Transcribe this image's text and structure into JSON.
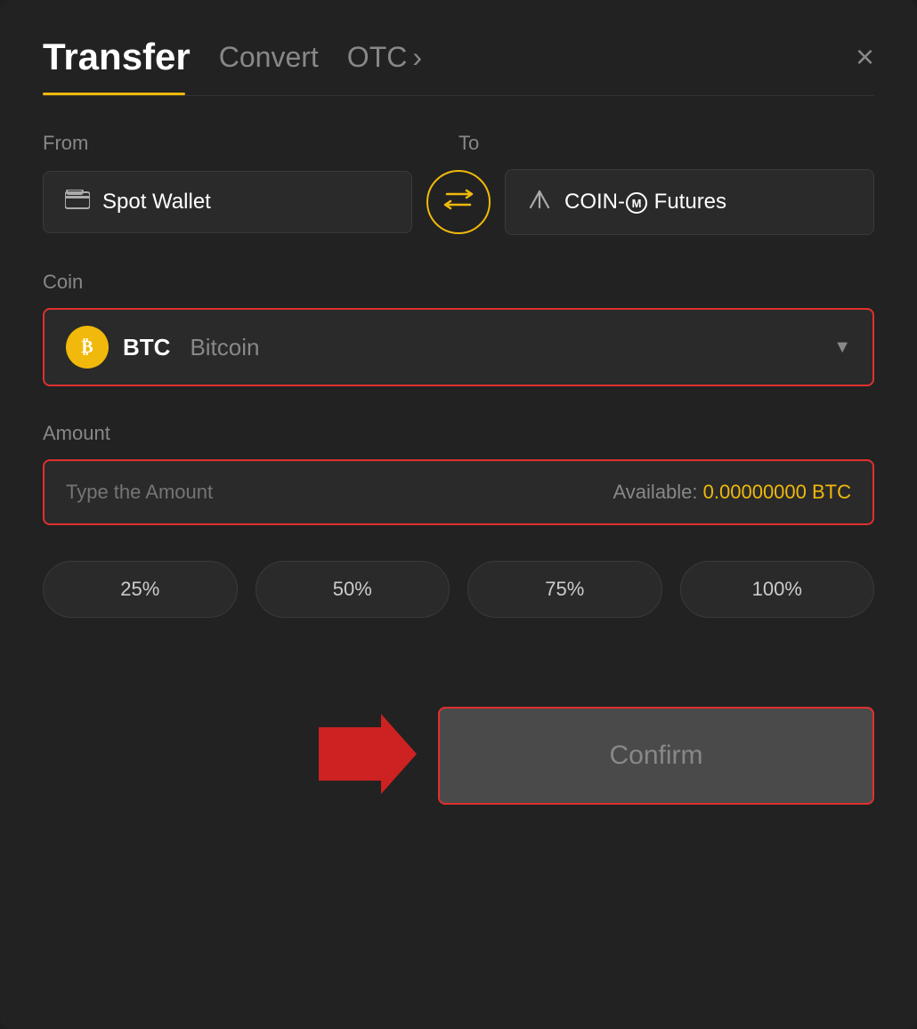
{
  "header": {
    "title": "Transfer",
    "tab_convert": "Convert",
    "tab_otc": "OTC",
    "tab_otc_chevron": "›",
    "close_label": "×"
  },
  "from_section": {
    "label": "From",
    "wallet_icon": "▬",
    "wallet_text": "Spot Wallet"
  },
  "to_section": {
    "label": "To",
    "wallet_icon": "↑",
    "wallet_text": "COIN-M Futures"
  },
  "swap": {
    "icon": "⇄"
  },
  "coin_section": {
    "label": "Coin",
    "coin_symbol": "BTC",
    "coin_name": "Bitcoin",
    "coin_icon": "₿"
  },
  "amount_section": {
    "label": "Amount",
    "placeholder": "Type the Amount",
    "available_label": "Available:",
    "available_amount": "0.00000000 BTC"
  },
  "percent_buttons": [
    {
      "label": "25%"
    },
    {
      "label": "50%"
    },
    {
      "label": "75%"
    },
    {
      "label": "100%"
    }
  ],
  "confirm_button": {
    "label": "Confirm"
  }
}
